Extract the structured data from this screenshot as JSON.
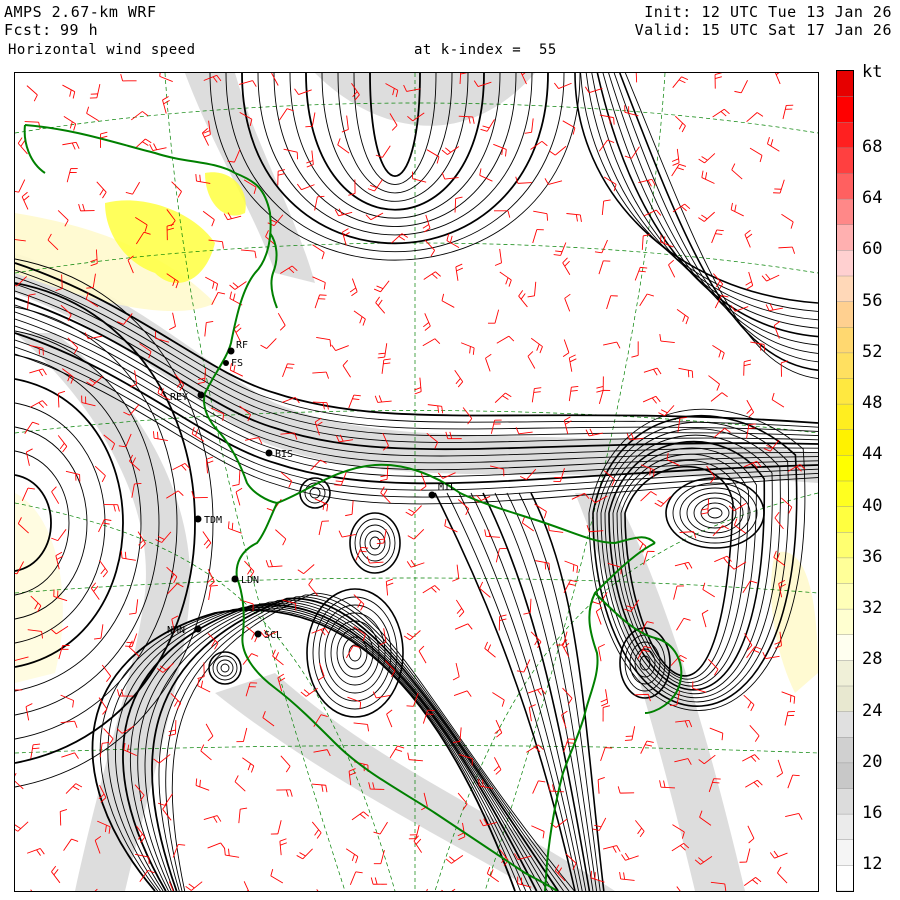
{
  "header": {
    "model": "AMPS 2.67-km WRF",
    "fcst_label": "Fcst:",
    "fcst_value": "99 h",
    "field": "Horizontal wind speed",
    "level": "at k-index =  55",
    "init": "Init: 12 UTC Tue 13 Jan 26",
    "valid": "Valid: 15 UTC Sat 17 Jan 26"
  },
  "colorbar": {
    "unit": "kt",
    "ticks": [
      "68",
      "64",
      "60",
      "56",
      "52",
      "48",
      "44",
      "40",
      "36",
      "32",
      "28",
      "24",
      "20",
      "16",
      "12"
    ],
    "bands": [
      {
        "from": 72,
        "to": 74,
        "color": "#e60000"
      },
      {
        "from": 70,
        "to": 72,
        "color": "#ff0000"
      },
      {
        "from": 68,
        "to": 70,
        "color": "#ff2020"
      },
      {
        "from": 66,
        "to": 68,
        "color": "#ff4040"
      },
      {
        "from": 64,
        "to": 66,
        "color": "#ff6060"
      },
      {
        "from": 62,
        "to": 64,
        "color": "#ff8888"
      },
      {
        "from": 60,
        "to": 62,
        "color": "#ffb0b0"
      },
      {
        "from": 58,
        "to": 60,
        "color": "#ffd0d0"
      },
      {
        "from": 56,
        "to": 58,
        "color": "#ffd8b8"
      },
      {
        "from": 54,
        "to": 56,
        "color": "#ffd090"
      },
      {
        "from": 52,
        "to": 54,
        "color": "#ffd870"
      },
      {
        "from": 50,
        "to": 52,
        "color": "#ffe060"
      },
      {
        "from": 48,
        "to": 50,
        "color": "#ffe840"
      },
      {
        "from": 46,
        "to": 48,
        "color": "#ffee20"
      },
      {
        "from": 44,
        "to": 46,
        "color": "#fff200"
      },
      {
        "from": 42,
        "to": 44,
        "color": "#ffff00"
      },
      {
        "from": 40,
        "to": 42,
        "color": "#ffff20"
      },
      {
        "from": 38,
        "to": 40,
        "color": "#ffff40"
      },
      {
        "from": 36,
        "to": 38,
        "color": "#ffff70"
      },
      {
        "from": 34,
        "to": 36,
        "color": "#ffff98"
      },
      {
        "from": 32,
        "to": 34,
        "color": "#ffffb8"
      },
      {
        "from": 30,
        "to": 32,
        "color": "#ffffd0"
      },
      {
        "from": 28,
        "to": 30,
        "color": "#fffff0"
      },
      {
        "from": 26,
        "to": 28,
        "color": "#f0f0d8"
      },
      {
        "from": 24,
        "to": 26,
        "color": "#e8e8d0"
      },
      {
        "from": 22,
        "to": 24,
        "color": "#e0e0e0"
      },
      {
        "from": 20,
        "to": 22,
        "color": "#d0d0d0"
      },
      {
        "from": 18,
        "to": 20,
        "color": "#c8c8c8"
      },
      {
        "from": 16,
        "to": 18,
        "color": "#dcdcdc"
      },
      {
        "from": 14,
        "to": 16,
        "color": "#ebebeb"
      },
      {
        "from": 12,
        "to": 14,
        "color": "#f5f5f5"
      },
      {
        "from": 10,
        "to": 12,
        "color": "#ffffff"
      }
    ]
  },
  "stations": [
    "RF",
    "FS",
    "REY",
    "BIS",
    "MIL",
    "TDM",
    "LDN",
    "NHN",
    "SCL"
  ],
  "colors": {
    "streamline": "#000000",
    "wind_barb": "#ff0000",
    "coastline": "#008000",
    "grid": "#008000",
    "shade_grey": "#cfcfcf",
    "shade_yellow": "#ffff40",
    "shade_cream": "#fffacd"
  }
}
